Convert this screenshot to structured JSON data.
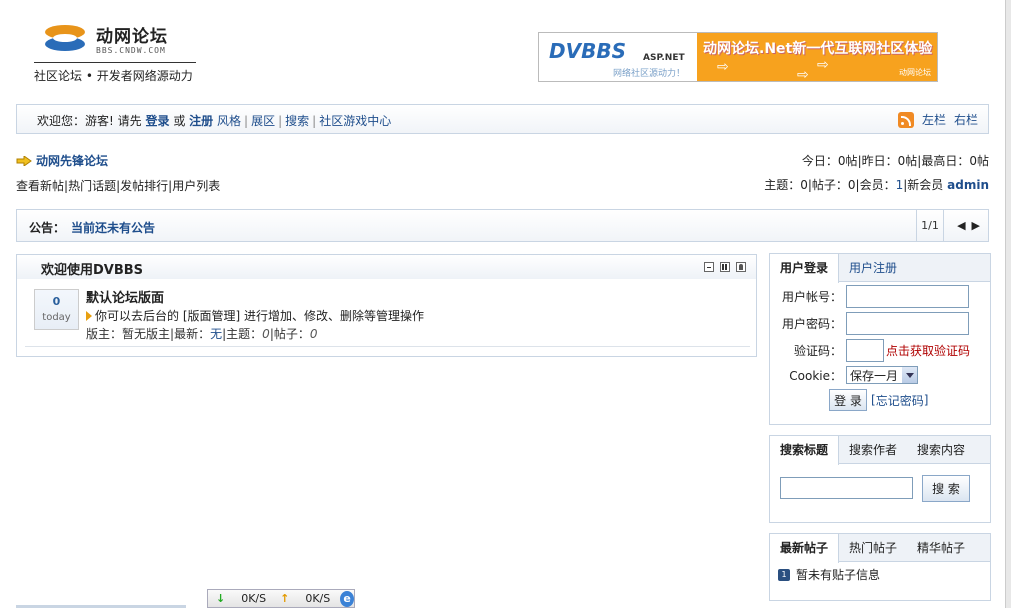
{
  "logo": {
    "name": "动网论坛",
    "url": "BBS.CNDW.COM",
    "slogan": "社区论坛 • 开发者网络源动力"
  },
  "banner": {
    "brand": "DVBBS",
    "brand_suffix": "ASP.NET",
    "brand_sub": "网络社区源动力！",
    "headline": "动网论坛.Net新一代互联网社区体验",
    "mini": "动网论坛"
  },
  "nav": {
    "welcome": "欢迎您：游客! 请先",
    "login": "登录",
    "or": "或",
    "register": "注册",
    "style": "风格",
    "expo": "展区",
    "search": "搜索",
    "game": "社区游戏中心",
    "left_col": "左栏",
    "right_col": "右栏"
  },
  "forum": {
    "title": "动网先锋论坛",
    "links": [
      "查看新帖",
      "热门话题",
      "发帖排行",
      "用户列表"
    ],
    "today_label": "今日：",
    "today_val": "0",
    "today_unit": "帖",
    "yesterday_label": "昨日：",
    "yesterday_val": "0",
    "yesterday_unit": "帖",
    "max_label": "最高日：",
    "max_val": "0",
    "max_unit": "帖",
    "topics_label": "主题：",
    "topics_val": "0",
    "posts_label": "帖子：",
    "posts_val": "0",
    "members_label": "会员：",
    "members_val": "1",
    "newmember_label": "新会员",
    "newmember_val": "admin"
  },
  "notice": {
    "label": "公告：",
    "text": "当前还未有公告",
    "pager": "1/1"
  },
  "welcome": {
    "title": "欢迎使用DVBBS",
    "today_count": "0",
    "today_label": "today",
    "board_name": "默认论坛版面",
    "desc": "你可以去后台的 [版面管理] 进行增加、修改、删除等管理操作",
    "moderator_label": "版主：",
    "moderator_val": "暂无版主",
    "latest_label": "最新：",
    "latest_val": "无",
    "topics_label": "主题：",
    "topics_val": "0",
    "posts_label": "帖子：",
    "posts_val": "0"
  },
  "login": {
    "tab_login": "用户登录",
    "tab_register": "用户注册",
    "account_label": "用户帐号：",
    "password_label": "用户密码：",
    "captcha_label": "验证码：",
    "captcha_link": "点击获取验证码",
    "cookie_label": "Cookie：",
    "cookie_value": "保存一月",
    "login_btn": "登 录",
    "forgot": "忘记密码"
  },
  "search": {
    "tab_title": "搜索标题",
    "tab_author": "搜索作者",
    "tab_content": "搜索内容",
    "btn": "搜 索"
  },
  "posts": {
    "tab_new": "最新帖子",
    "tab_hot": "热门帖子",
    "tab_best": "精华帖子",
    "empty": "暂未有贴子信息",
    "badge": "1"
  },
  "statusbar": {
    "down": "0K/S",
    "up": "0K/S"
  },
  "colors": {
    "link": "#1f4e8c",
    "border": "#c9d5e3",
    "banner_orange": "#f7a21e",
    "captcha_red": "#b00000"
  }
}
